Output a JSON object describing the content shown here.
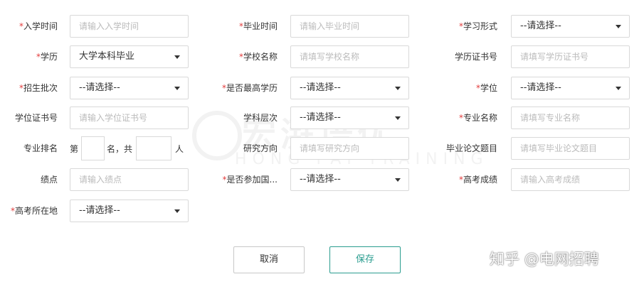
{
  "form": {
    "required_mark": "*",
    "rows": [
      [
        {
          "label": "入学时间",
          "required": true,
          "type": "input",
          "placeholder": "请输入入学时间"
        },
        {
          "label": "毕业时间",
          "required": true,
          "type": "input",
          "placeholder": "请输入毕业时间"
        },
        {
          "label": "学习形式",
          "required": true,
          "type": "select",
          "value": "--请选择--"
        }
      ],
      [
        {
          "label": "学历",
          "required": true,
          "type": "select",
          "value": "大学本科毕业"
        },
        {
          "label": "学校名称",
          "required": true,
          "type": "input",
          "placeholder": "请填写学校名称"
        },
        {
          "label": "学历证书号",
          "required": false,
          "type": "input",
          "placeholder": "请填写学历证书号"
        }
      ],
      [
        {
          "label": "招生批次",
          "required": true,
          "type": "select",
          "value": "--请选择--"
        },
        {
          "label": "是否最高学历",
          "required": true,
          "type": "select",
          "value": "--请选择--"
        },
        {
          "label": "学位",
          "required": true,
          "type": "select",
          "value": "--请选择--"
        }
      ],
      [
        {
          "label": "学位证书号",
          "required": false,
          "type": "input",
          "placeholder": "请输入学位证书号"
        },
        {
          "label": "学科层次",
          "required": false,
          "type": "select",
          "value": "--请选择--"
        },
        {
          "label": "专业名称",
          "required": true,
          "type": "input",
          "placeholder": "请填写专业名称"
        }
      ],
      [
        {
          "label": "专业排名",
          "required": false,
          "type": "rank"
        },
        {
          "label": "研究方向",
          "required": false,
          "type": "input",
          "placeholder": "请填写研究方向"
        },
        {
          "label": "毕业论文题目",
          "required": false,
          "type": "input",
          "placeholder": "请填写毕业论文题目"
        }
      ],
      [
        {
          "label": "绩点",
          "required": false,
          "type": "input",
          "placeholder": "请输入绩点"
        },
        {
          "label": "是否参加国...",
          "required": true,
          "type": "select",
          "value": "--请选择--"
        },
        {
          "label": "高考成绩",
          "required": true,
          "type": "input",
          "placeholder": "请输入高考成绩"
        }
      ],
      [
        {
          "label": "高考所在地",
          "required": true,
          "type": "select",
          "value": "--请选择--"
        }
      ]
    ],
    "rank": {
      "prefix": "第",
      "middle": "名，共",
      "suffix": "人"
    }
  },
  "buttons": {
    "cancel": "取消",
    "save": "保存"
  },
  "watermark": {
    "big": "宏湃培优",
    "small": "HONG PAI TRAINING"
  },
  "corner_watermark": "知乎 @电网招聘",
  "colors": {
    "required": "#e33c3c",
    "save_accent": "#2a9d8f",
    "border": "#d9d9d9",
    "placeholder": "#bbbbbb"
  }
}
